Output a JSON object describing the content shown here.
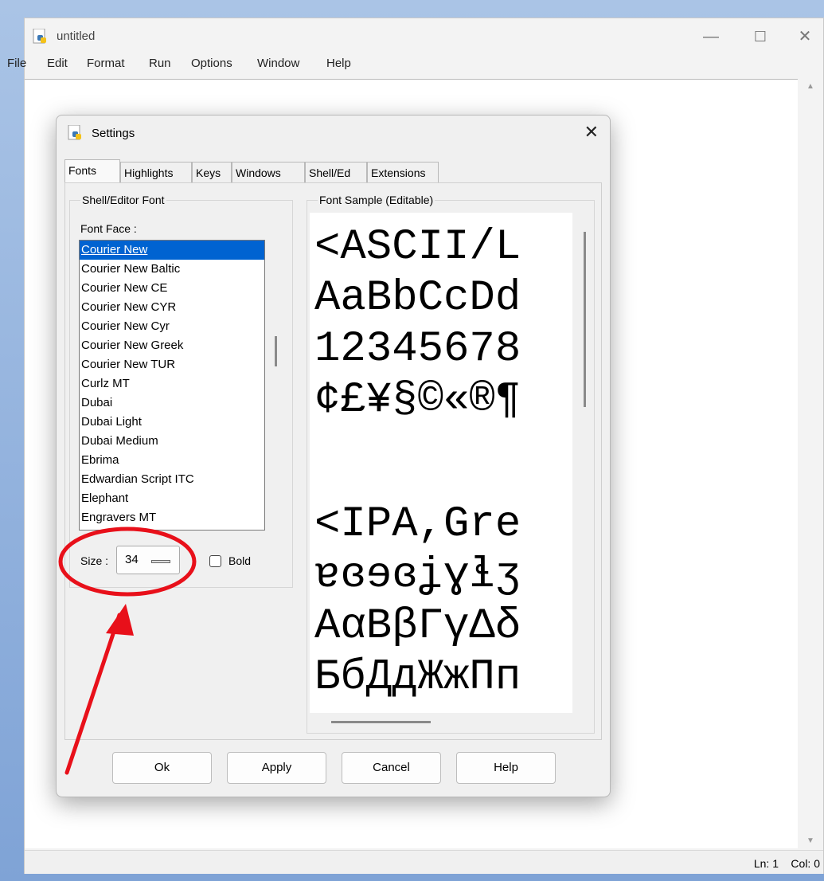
{
  "window": {
    "title": "untitled",
    "controls": {
      "minimize": "—",
      "maximize": "☐",
      "close": "✕"
    }
  },
  "menu": [
    "File",
    "Edit",
    "Format",
    "Run",
    "Options",
    "Window",
    "Help"
  ],
  "status": {
    "line": "Ln: 1",
    "col": "Col: 0"
  },
  "dialog": {
    "title": "Settings",
    "close": "✕",
    "tabs": [
      "Fonts",
      "Highlights",
      "Keys",
      "Windows",
      "Shell/Ed",
      "Extensions"
    ],
    "active_tab": "Fonts",
    "font_group_title": "Shell/Editor Font",
    "font_face_label": "Font Face :",
    "fonts": [
      "Courier New",
      "Courier New Baltic",
      "Courier New CE",
      "Courier New CYR",
      "Courier New Cyr",
      "Courier New Greek",
      "Courier New TUR",
      "Curlz MT",
      "Dubai",
      "Dubai Light",
      "Dubai Medium",
      "Ebrima",
      "Edwardian Script ITC",
      "Elephant",
      "Engravers MT"
    ],
    "selected_font": "Courier New",
    "size_label": "Size :",
    "size_value": "34",
    "bold_label": "Bold",
    "bold_checked": false,
    "sample_title": "Font Sample (Editable)",
    "sample_lines": [
      "<ASCII/L",
      "AaBbCcDd",
      "12345678",
      "¢£¥§©«®¶",
      "",
      "<IPA,Gre",
      "ɐɞɘɞʝɣɬʒ",
      "AαBβΓγΔδ",
      "БбДдЖжПп"
    ],
    "buttons": {
      "ok": "Ok",
      "apply": "Apply",
      "cancel": "Cancel",
      "help": "Help"
    }
  },
  "annotation_color": "#e8101a"
}
